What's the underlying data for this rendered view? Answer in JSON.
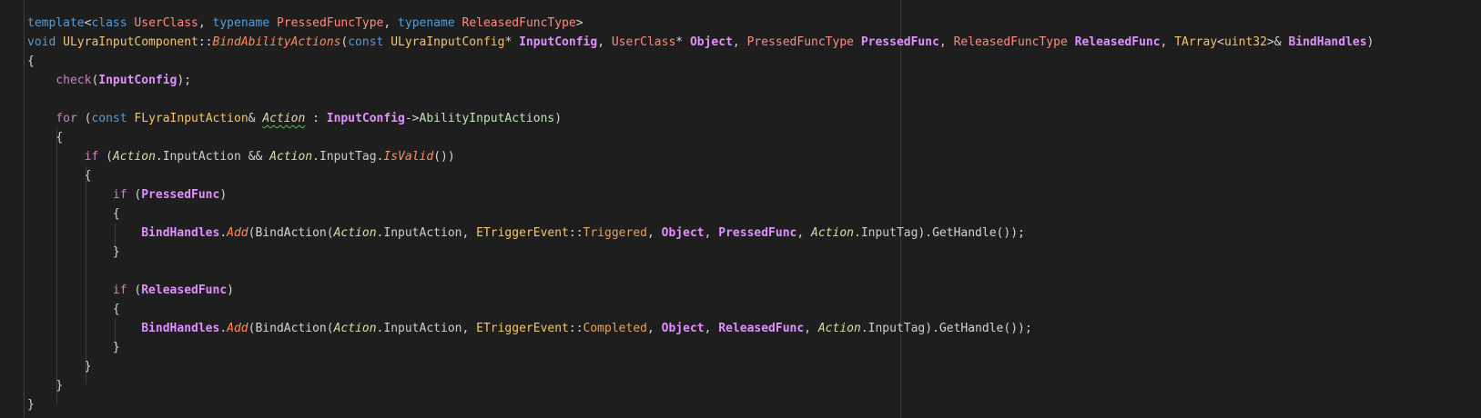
{
  "editor": {
    "lines": [
      [
        {
          "t": "template",
          "c": "t-kw"
        },
        {
          "t": "<",
          "c": "t-op"
        },
        {
          "t": "class",
          "c": "t-kw"
        },
        {
          "t": " ",
          "c": ""
        },
        {
          "t": "UserClass",
          "c": "t-tp"
        },
        {
          "t": ", ",
          "c": "t-op"
        },
        {
          "t": "typename",
          "c": "t-kw"
        },
        {
          "t": " ",
          "c": ""
        },
        {
          "t": "PressedFuncType",
          "c": "t-tp"
        },
        {
          "t": ", ",
          "c": "t-op"
        },
        {
          "t": "typename",
          "c": "t-kw"
        },
        {
          "t": " ",
          "c": ""
        },
        {
          "t": "ReleasedFuncType",
          "c": "t-tp"
        },
        {
          "t": ">",
          "c": "t-op"
        }
      ],
      [
        {
          "t": "void",
          "c": "t-kw"
        },
        {
          "t": " ",
          "c": ""
        },
        {
          "t": "ULyraInputComponent",
          "c": "t-cls"
        },
        {
          "t": "::",
          "c": "t-op"
        },
        {
          "t": "BindAbilityActions",
          "c": "t-fnI"
        },
        {
          "t": "(",
          "c": "t-op"
        },
        {
          "t": "const",
          "c": "t-kw"
        },
        {
          "t": " ",
          "c": ""
        },
        {
          "t": "ULyraInputConfig",
          "c": "t-cls"
        },
        {
          "t": "* ",
          "c": "t-op"
        },
        {
          "t": "InputConfig",
          "c": "t-pmB"
        },
        {
          "t": ", ",
          "c": "t-op"
        },
        {
          "t": "UserClass",
          "c": "t-tp"
        },
        {
          "t": "* ",
          "c": "t-op"
        },
        {
          "t": "Object",
          "c": "t-pmB"
        },
        {
          "t": ", ",
          "c": "t-op"
        },
        {
          "t": "PressedFuncType",
          "c": "t-tp"
        },
        {
          "t": " ",
          "c": ""
        },
        {
          "t": "PressedFunc",
          "c": "t-pmB"
        },
        {
          "t": ", ",
          "c": "t-op"
        },
        {
          "t": "ReleasedFuncType",
          "c": "t-tp"
        },
        {
          "t": " ",
          "c": ""
        },
        {
          "t": "ReleasedFunc",
          "c": "t-pmB"
        },
        {
          "t": ", ",
          "c": "t-op"
        },
        {
          "t": "TArray",
          "c": "t-cls"
        },
        {
          "t": "<",
          "c": "t-op"
        },
        {
          "t": "uint32",
          "c": "t-uint"
        },
        {
          "t": ">& ",
          "c": "t-op"
        },
        {
          "t": "BindHandles",
          "c": "t-pmB"
        },
        {
          "t": ")",
          "c": "t-op"
        }
      ],
      [
        {
          "t": "{",
          "c": "t-op"
        }
      ],
      [
        {
          "t": "    ",
          "c": ""
        },
        {
          "t": "check",
          "c": "t-mac"
        },
        {
          "t": "(",
          "c": "t-op"
        },
        {
          "t": "InputConfig",
          "c": "t-pmB"
        },
        {
          "t": ");",
          "c": "t-op"
        }
      ],
      [],
      [
        {
          "t": "    ",
          "c": ""
        },
        {
          "t": "for",
          "c": "t-ctl"
        },
        {
          "t": " (",
          "c": "t-op"
        },
        {
          "t": "const",
          "c": "t-kw"
        },
        {
          "t": " ",
          "c": ""
        },
        {
          "t": "FLyraInputAction",
          "c": "t-cls"
        },
        {
          "t": "& ",
          "c": "t-op"
        },
        {
          "t": "Action",
          "c": "t-lv squiggle"
        },
        {
          "t": " : ",
          "c": "t-op"
        },
        {
          "t": "InputConfig",
          "c": "t-pmB"
        },
        {
          "t": "->",
          "c": "t-op"
        },
        {
          "t": "AbilityInputActions",
          "c": "t-amem"
        },
        {
          "t": ")",
          "c": "t-op"
        }
      ],
      [
        {
          "t": "    ",
          "c": ""
        },
        {
          "t": "{",
          "c": "t-op"
        }
      ],
      [
        {
          "t": "        ",
          "c": ""
        },
        {
          "t": "if",
          "c": "t-ctl"
        },
        {
          "t": " (",
          "c": "t-op"
        },
        {
          "t": "Action",
          "c": "t-lv"
        },
        {
          "t": ".",
          "c": "t-op"
        },
        {
          "t": "InputAction",
          "c": "t-dim"
        },
        {
          "t": " && ",
          "c": "t-op"
        },
        {
          "t": "Action",
          "c": "t-lv"
        },
        {
          "t": ".",
          "c": "t-op"
        },
        {
          "t": "InputTag",
          "c": "t-dim"
        },
        {
          "t": ".",
          "c": "t-op"
        },
        {
          "t": "IsValid",
          "c": "t-fnI"
        },
        {
          "t": "())",
          "c": "t-op"
        }
      ],
      [
        {
          "t": "        ",
          "c": ""
        },
        {
          "t": "{",
          "c": "t-op"
        }
      ],
      [
        {
          "t": "            ",
          "c": ""
        },
        {
          "t": "if",
          "c": "t-ctl"
        },
        {
          "t": " (",
          "c": "t-op"
        },
        {
          "t": "PressedFunc",
          "c": "t-pmB"
        },
        {
          "t": ")",
          "c": "t-op"
        }
      ],
      [
        {
          "t": "            ",
          "c": ""
        },
        {
          "t": "{",
          "c": "t-op"
        }
      ],
      [
        {
          "t": "                ",
          "c": ""
        },
        {
          "t": "BindHandles",
          "c": "t-pmB"
        },
        {
          "t": ".",
          "c": "t-op"
        },
        {
          "t": "Add",
          "c": "t-fnI"
        },
        {
          "t": "(",
          "c": "t-op"
        },
        {
          "t": "BindAction",
          "c": "t-fnc"
        },
        {
          "t": "(",
          "c": "t-op"
        },
        {
          "t": "Action",
          "c": "t-lv"
        },
        {
          "t": ".",
          "c": "t-op"
        },
        {
          "t": "InputAction",
          "c": "t-dim"
        },
        {
          "t": ", ",
          "c": "t-op"
        },
        {
          "t": "ETriggerEvent",
          "c": "t-cls"
        },
        {
          "t": "::",
          "c": "t-op"
        },
        {
          "t": "Triggered",
          "c": "t-en"
        },
        {
          "t": ", ",
          "c": "t-op"
        },
        {
          "t": "Object",
          "c": "t-pmB"
        },
        {
          "t": ", ",
          "c": "t-op"
        },
        {
          "t": "PressedFunc",
          "c": "t-pmB"
        },
        {
          "t": ", ",
          "c": "t-op"
        },
        {
          "t": "Action",
          "c": "t-lv"
        },
        {
          "t": ".",
          "c": "t-op"
        },
        {
          "t": "InputTag",
          "c": "t-dim"
        },
        {
          "t": ").",
          "c": "t-op"
        },
        {
          "t": "GetHandle",
          "c": "t-fnc"
        },
        {
          "t": "());",
          "c": "t-op"
        }
      ],
      [
        {
          "t": "            ",
          "c": ""
        },
        {
          "t": "}",
          "c": "t-op"
        }
      ],
      [],
      [
        {
          "t": "            ",
          "c": ""
        },
        {
          "t": "if",
          "c": "t-ctl"
        },
        {
          "t": " (",
          "c": "t-op"
        },
        {
          "t": "ReleasedFunc",
          "c": "t-pmB"
        },
        {
          "t": ")",
          "c": "t-op"
        }
      ],
      [
        {
          "t": "            ",
          "c": ""
        },
        {
          "t": "{",
          "c": "t-op"
        }
      ],
      [
        {
          "t": "                ",
          "c": ""
        },
        {
          "t": "BindHandles",
          "c": "t-pmB"
        },
        {
          "t": ".",
          "c": "t-op"
        },
        {
          "t": "Add",
          "c": "t-fnI"
        },
        {
          "t": "(",
          "c": "t-op"
        },
        {
          "t": "BindAction",
          "c": "t-fnc"
        },
        {
          "t": "(",
          "c": "t-op"
        },
        {
          "t": "Action",
          "c": "t-lv"
        },
        {
          "t": ".",
          "c": "t-op"
        },
        {
          "t": "InputAction",
          "c": "t-dim"
        },
        {
          "t": ", ",
          "c": "t-op"
        },
        {
          "t": "ETriggerEvent",
          "c": "t-cls"
        },
        {
          "t": "::",
          "c": "t-op"
        },
        {
          "t": "Completed",
          "c": "t-en"
        },
        {
          "t": ", ",
          "c": "t-op"
        },
        {
          "t": "Object",
          "c": "t-pmB"
        },
        {
          "t": ", ",
          "c": "t-op"
        },
        {
          "t": "ReleasedFunc",
          "c": "t-pmB"
        },
        {
          "t": ", ",
          "c": "t-op"
        },
        {
          "t": "Action",
          "c": "t-lv"
        },
        {
          "t": ".",
          "c": "t-op"
        },
        {
          "t": "InputTag",
          "c": "t-dim"
        },
        {
          "t": ").",
          "c": "t-op"
        },
        {
          "t": "GetHandle",
          "c": "t-fnc"
        },
        {
          "t": "());",
          "c": "t-op"
        }
      ],
      [
        {
          "t": "            ",
          "c": ""
        },
        {
          "t": "}",
          "c": "t-op"
        }
      ],
      [
        {
          "t": "        ",
          "c": ""
        },
        {
          "t": "}",
          "c": "t-op"
        }
      ],
      [
        {
          "t": "    ",
          "c": ""
        },
        {
          "t": "}",
          "c": "t-op"
        }
      ],
      [
        {
          "t": "}",
          "c": "t-op"
        }
      ]
    ]
  }
}
